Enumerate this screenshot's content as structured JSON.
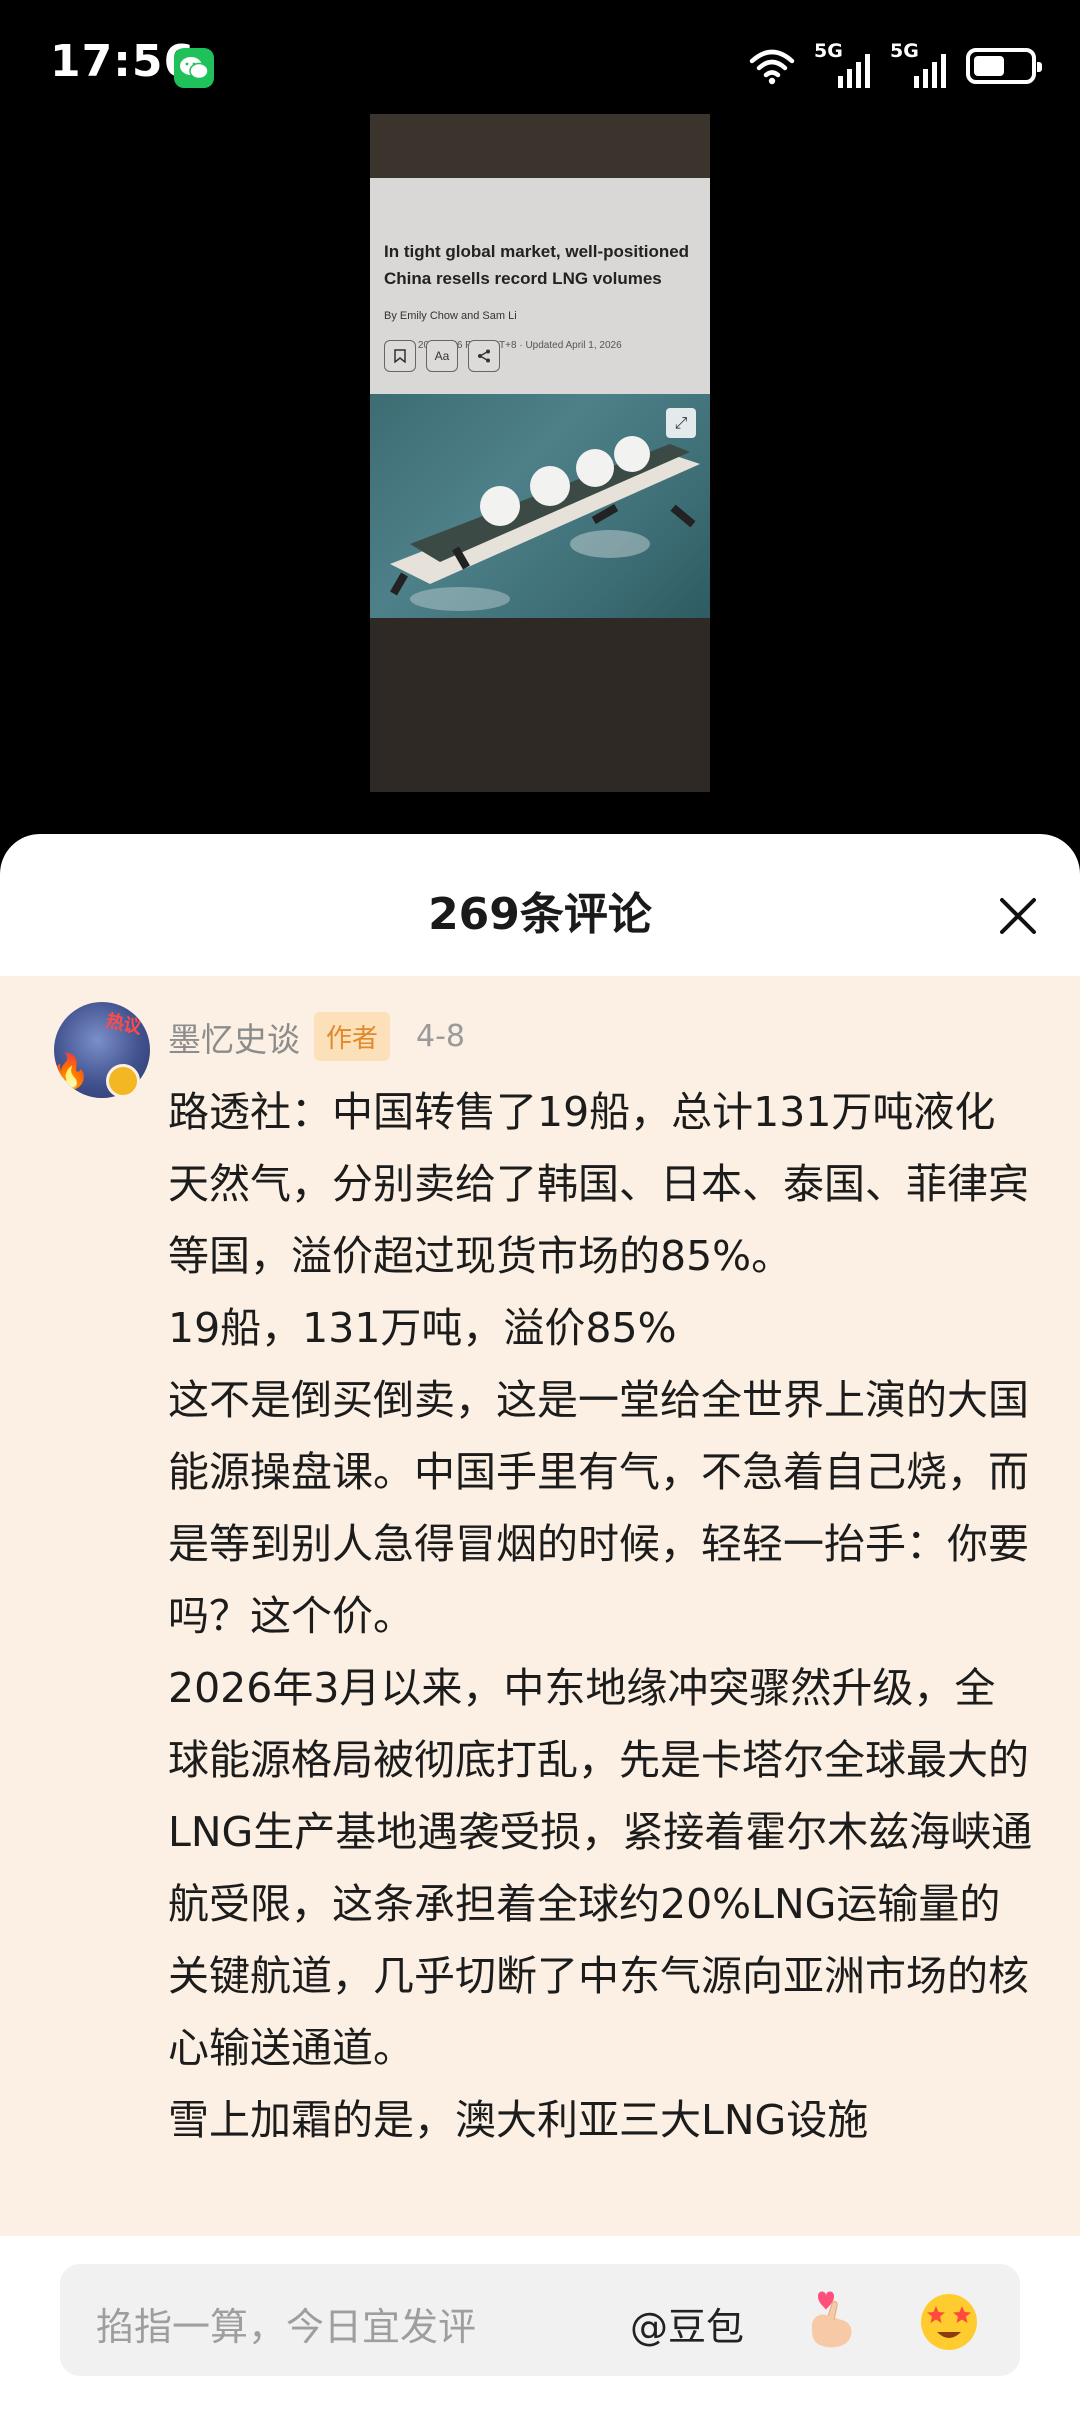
{
  "status_bar": {
    "time": "17:56",
    "signal_1": "5G",
    "signal_2": "5G"
  },
  "preview": {
    "headline": "In tight global market, well-positioned China resells record LNG volumes",
    "byline": "By Emily Chow and Sam Li",
    "date": "April 1, 2026 2:56 PM GMT+8 · Updated April 1, 2026",
    "font_button": "Aa"
  },
  "sheet": {
    "title": "269条评论"
  },
  "comment": {
    "user": "墨忆史谈",
    "author_tag": "作者",
    "date": "4-8",
    "avatar_tag": "热议",
    "paragraphs": [
      "路透社：中国转售了19船，总计131万吨液化天然气，分别卖给了韩国、日本、泰国、菲律宾等国，溢价超过现货市场的85%。",
      "19船，131万吨，溢价85%",
      "这不是倒买倒卖，这是一堂给全世界上演的大国能源操盘课。中国手里有气，不急着自己烧，而是等到别人急得冒烟的时候，轻轻一抬手：你要吗？这个价。",
      "2026年3月以来，中东地缘冲突骤然升级，全球能源格局被彻底打乱，先是卡塔尔全球最大的LNG生产基地遇袭受损，紧接着霍尔木兹海峡通航受限，这条承担着全球约20%LNG运输量的关键航道，几乎切断了中东气源向亚洲市场的核心输送通道。",
      "雪上加霜的是，澳大利亚三大LNG设施"
    ]
  },
  "input_bar": {
    "placeholder": "掐指一算，今日宜发评",
    "mention": "@豆包"
  }
}
